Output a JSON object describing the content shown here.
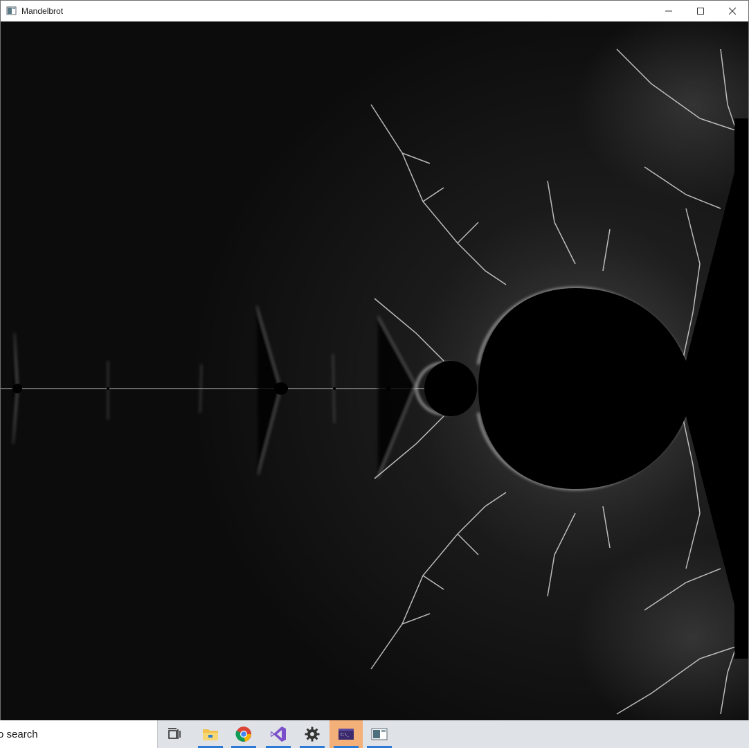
{
  "window": {
    "title": "Mandelbrot"
  },
  "caption": {
    "minimize_icon": "minimize-icon",
    "maximize_icon": "maximize-icon",
    "close_icon": "close-icon"
  },
  "canvas": {
    "content": "mandelbrot-fractal-render",
    "palette": [
      "#000000",
      "#0b0b0b",
      "#1a1a1a",
      "#3a3a3a",
      "#8a8a8a",
      "#e8e8e8"
    ]
  },
  "taskbar": {
    "search_text": "o search",
    "apps": [
      {
        "name": "task-view",
        "icon": "task-view-icon",
        "running": false
      },
      {
        "name": "file-explorer",
        "icon": "folder-icon",
        "running": true
      },
      {
        "name": "chrome",
        "icon": "chrome-icon",
        "running": true
      },
      {
        "name": "visual-studio",
        "icon": "visual-studio-icon",
        "running": true
      },
      {
        "name": "settings",
        "icon": "gear-icon",
        "running": true
      },
      {
        "name": "console",
        "icon": "console-icon",
        "running": true,
        "active": true
      },
      {
        "name": "mandelbrot-app",
        "icon": "app-window-icon",
        "running": true
      }
    ],
    "colors": {
      "background": "#dfe3e8",
      "running_indicator": "#2b7bd6",
      "active_highlight": "#f4b079"
    }
  }
}
